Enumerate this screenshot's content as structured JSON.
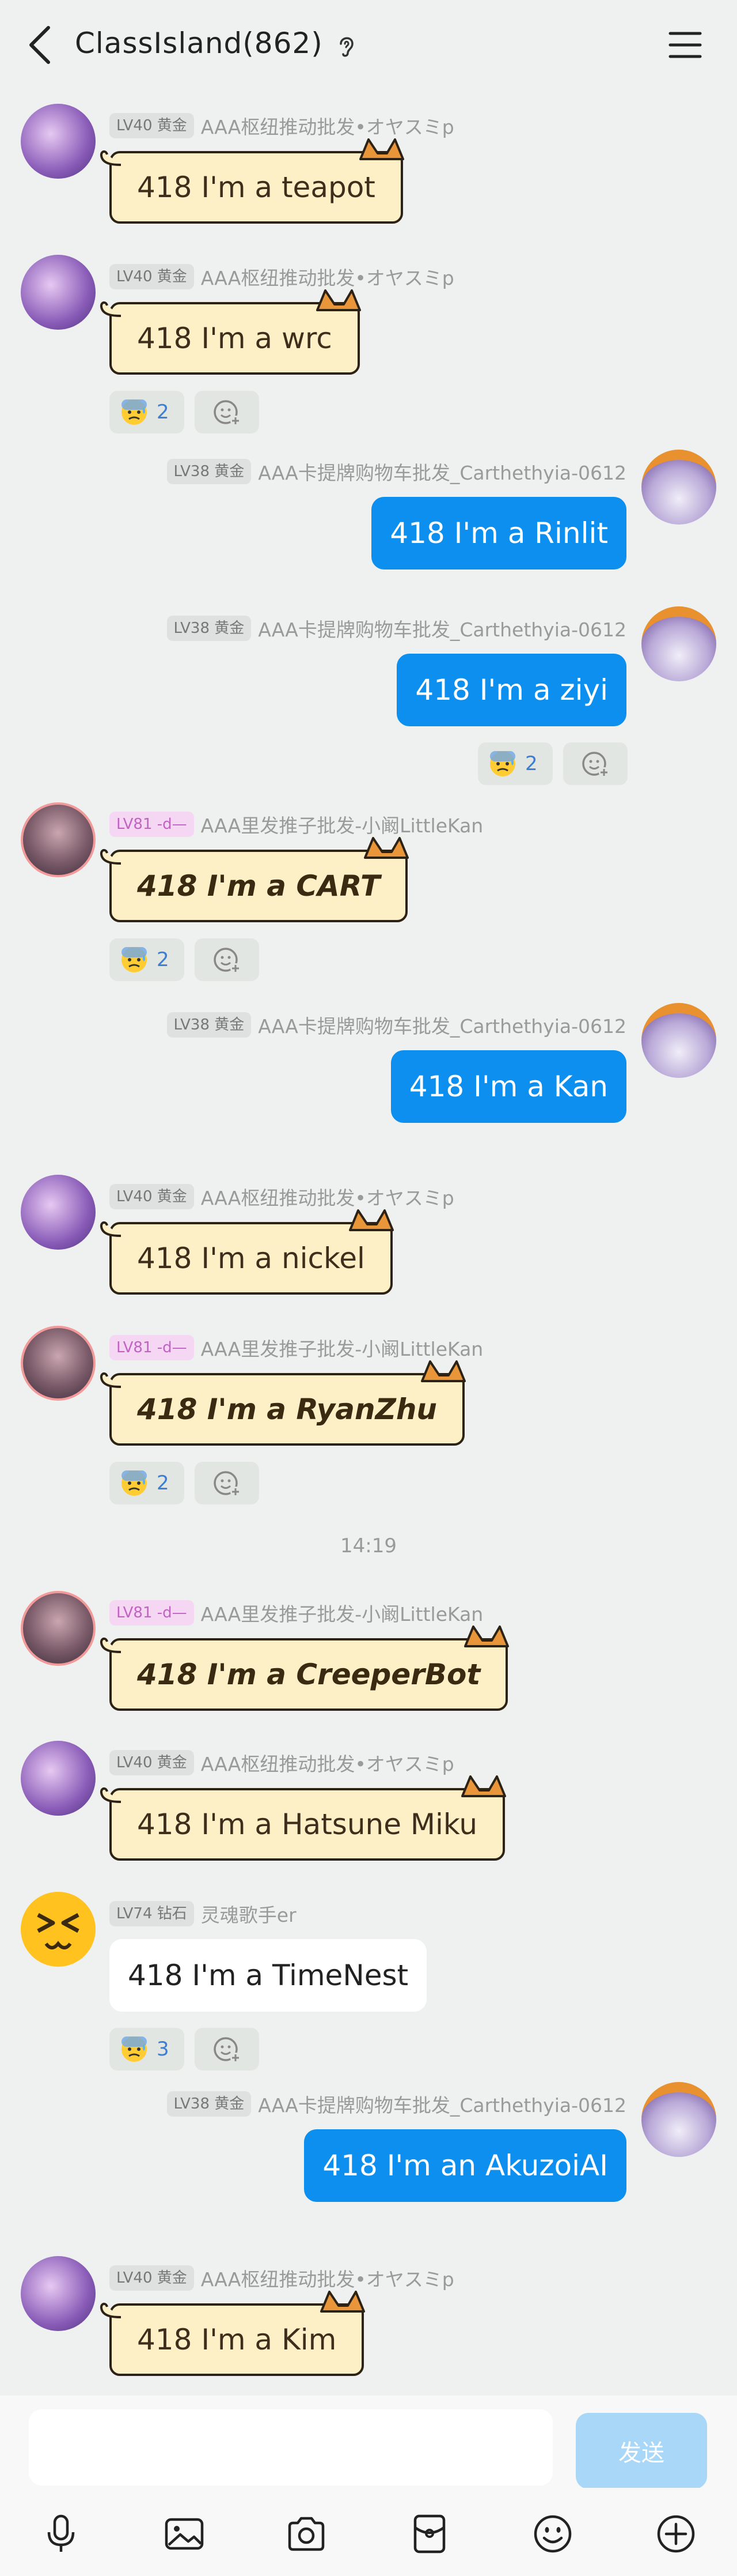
{
  "header": {
    "title": "ClassIsland(862)",
    "back_icon": "chevron-left-icon",
    "listen_icon": "ear-icon",
    "menu_icon": "hamburger-menu-icon"
  },
  "messages": [
    {
      "side": "left",
      "level": "LV40 黄金",
      "nick": "AAA枢纽推动批发•オヤスミp",
      "text": "418 I'm a teapot",
      "style": "cat"
    },
    {
      "side": "left",
      "level": "LV40 黄金",
      "nick": "AAA枢纽推动批发•オヤスミp",
      "text": "418 I'm a wrc",
      "style": "cat",
      "reaction_count": "2"
    },
    {
      "side": "right",
      "level": "LV38 黄金",
      "nick": "AAA卡提牌购物车批发_Carthethyia-0612",
      "text": "418 I'm a Rinlit",
      "style": "blue"
    },
    {
      "side": "right",
      "level": "LV38 黄金",
      "nick": "AAA卡提牌购物车批发_Carthethyia-0612",
      "text": "418 I'm a ziyi",
      "style": "blue",
      "reaction_count": "2"
    },
    {
      "side": "left",
      "level": "LV81 -d—",
      "nick": "AAA里发推子批发-小阚LittleKan",
      "text": "418 I'm a CART",
      "style": "cat-bold",
      "reaction_count": "2"
    },
    {
      "side": "right",
      "level": "LV38 黄金",
      "nick": "AAA卡提牌购物车批发_Carthethyia-0612",
      "text": "418 I'm a Kan",
      "style": "blue"
    },
    {
      "side": "left",
      "level": "LV40 黄金",
      "nick": "AAA枢纽推动批发•オヤスミp",
      "text": "418 I'm a nickel",
      "style": "cat"
    },
    {
      "side": "left",
      "level": "LV81 -d—",
      "nick": "AAA里发推子批发-小阚LittleKan",
      "text": "418 I'm a RyanZhu",
      "style": "cat-bold",
      "reaction_count": "2"
    },
    {
      "side": "left",
      "level": "LV81 -d—",
      "nick": "AAA里发推子批发-小阚LittleKan",
      "text": "418 I'm a CreeperBot",
      "style": "cat-bold"
    },
    {
      "side": "left",
      "level": "LV40 黄金",
      "nick": "AAA枢纽推动批发•オヤスミp",
      "text": "418 I'm a Hatsune Miku",
      "style": "cat"
    },
    {
      "side": "left",
      "level": "LV74 钻石",
      "nick": "灵魂歌手er",
      "text": "418 I'm a TimeNest",
      "style": "white",
      "reaction_count": "3"
    },
    {
      "side": "right",
      "level": "LV38 黄金",
      "nick": "AAA卡提牌购物车批发_Carthethyia-0612",
      "text": "418 I'm an AkuzoiAI",
      "style": "blue"
    },
    {
      "side": "left",
      "level": "LV40 黄金",
      "nick": "AAA枢纽推动批发•オヤスミp",
      "text": "418 I'm a Kim",
      "style": "cat"
    }
  ],
  "timestamp": "14:19",
  "reaction_emoji": "anxious-sweat-face-icon",
  "reaction_add_icon": "add-emoji-icon",
  "input": {
    "placeholder": "",
    "value": "",
    "send_label": "发送"
  },
  "toolbar_icons": [
    "microphone-icon",
    "image-icon",
    "camera-icon",
    "red-packet-icon",
    "emoji-icon",
    "plus-icon"
  ],
  "colors": {
    "background": "#eef1ef",
    "blue_bubble": "#0c8fee",
    "cat_bubble": "#fdf0c6",
    "send_disabled": "#a9d7f7"
  }
}
